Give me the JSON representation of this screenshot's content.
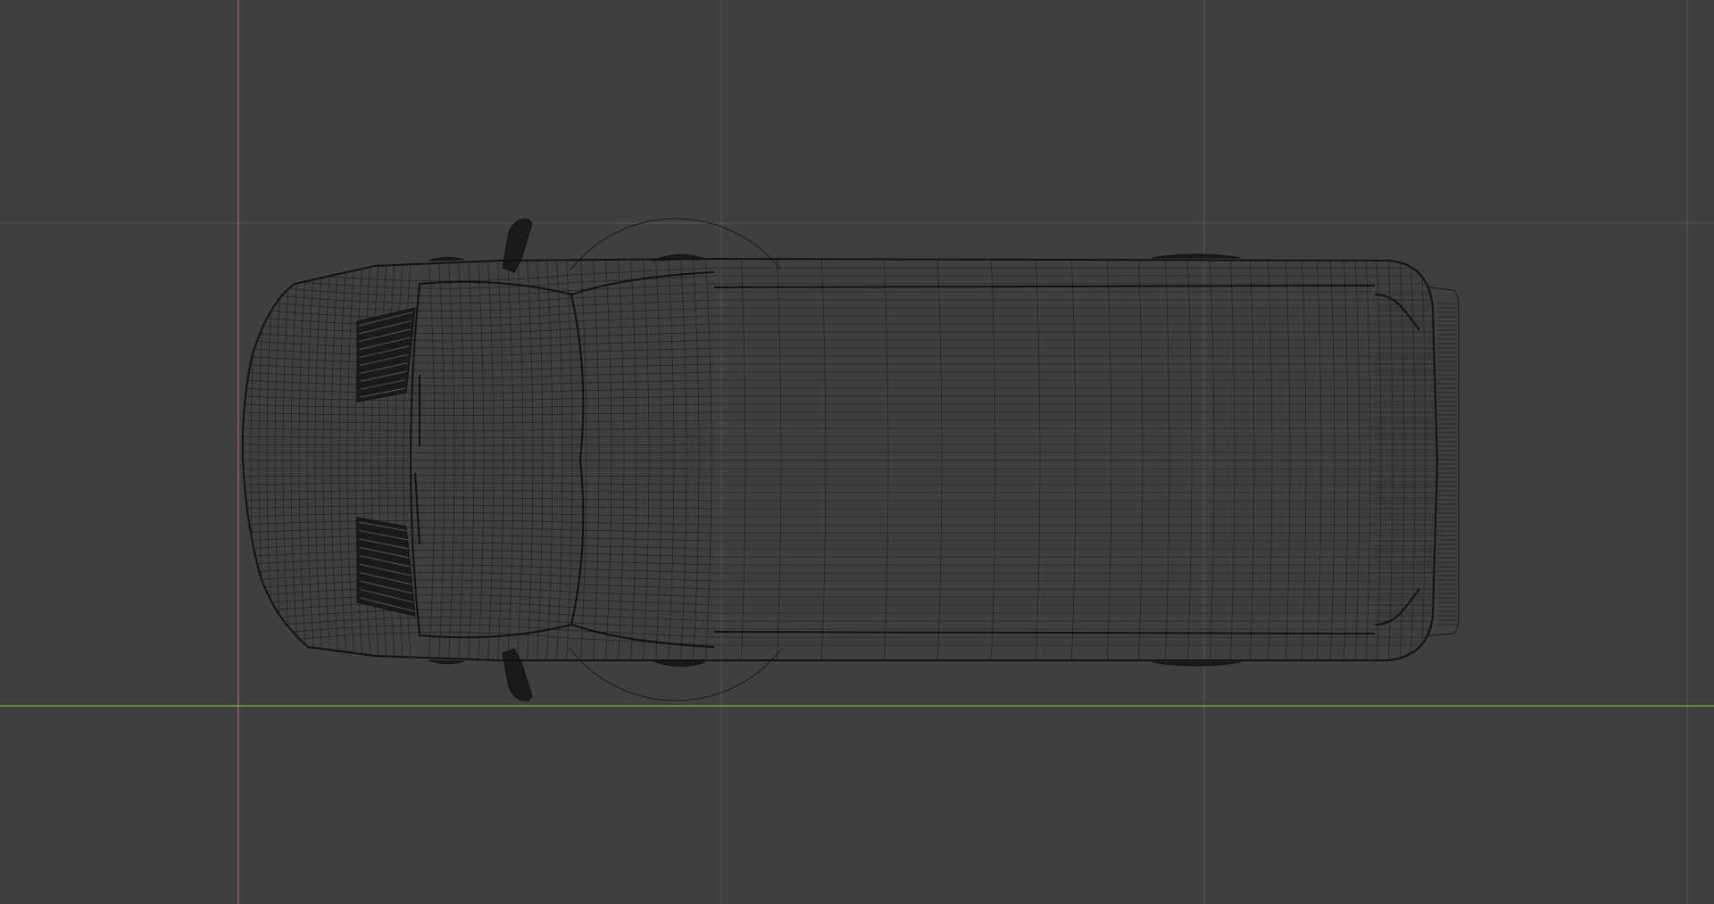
{
  "viewport": {
    "view": "top-orthographic",
    "shading": "wireframe",
    "object": "van",
    "colors": {
      "background": "#3f3f3f",
      "grid": "#555555",
      "x_axis": "#7b9a3a",
      "y_axis": "#9a5a5a",
      "wireframe": "#181818"
    },
    "icons": {
      "wire_model": "van-wireframe-icon",
      "wheel_arch": "circle-outline-icon"
    }
  }
}
